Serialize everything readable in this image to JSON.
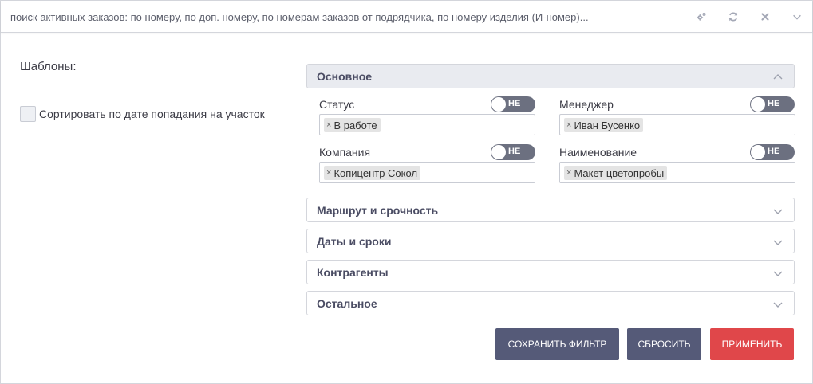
{
  "search": {
    "text": "поиск активных заказов: по номеру, по доп. номеру, по номерам заказов от подрядчика, по номеру изделия (И-номер)..."
  },
  "header_icons": [
    "settings-gears-icon",
    "refresh-icon",
    "close-icon",
    "chevron-down-icon"
  ],
  "left": {
    "templates_label": "Шаблоны:",
    "sort_label": "Сортировать по дате попадания на участок",
    "sort_checked": false
  },
  "sections": {
    "main": {
      "title": "Основное",
      "expanded": true,
      "fields": [
        {
          "label": "Статус",
          "toggle": "НЕ",
          "tag": "В работе"
        },
        {
          "label": "Менеджер",
          "toggle": "НЕ",
          "tag": "Иван Бусенко"
        },
        {
          "label": "Компания",
          "toggle": "НЕ",
          "tag": "Копицентр Сокол"
        },
        {
          "label": "Наименование",
          "toggle": "НЕ",
          "tag": "Макет цветопробы"
        }
      ]
    },
    "route": {
      "title": "Маршрут и срочность"
    },
    "dates": {
      "title": "Даты и сроки"
    },
    "contractors": {
      "title": "Контрагенты"
    },
    "other": {
      "title": "Остальное"
    }
  },
  "buttons": {
    "save": "Сохранить фильтр",
    "reset": "Сбросить",
    "apply": "Применить"
  },
  "colors": {
    "primary_button": "#555a78",
    "apply_button": "#e0474a",
    "section_header_open": "#e9ebf0",
    "toggle": "#6c7080"
  }
}
